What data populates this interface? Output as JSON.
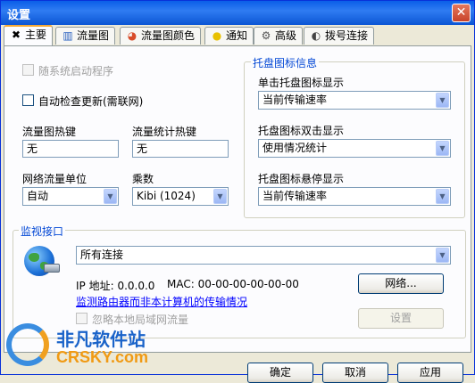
{
  "window": {
    "title": "设置",
    "close": "✕"
  },
  "tabs": [
    {
      "label": "主要",
      "icon": "wrench-icon",
      "glyph": "✖",
      "active": true
    },
    {
      "label": "流量图",
      "icon": "chart-icon",
      "glyph": "▥"
    },
    {
      "label": "流量图颜色",
      "icon": "palette-icon",
      "glyph": "◕"
    },
    {
      "label": "通知",
      "icon": "bulb-icon",
      "glyph": "💡"
    },
    {
      "label": "高级",
      "icon": "settings-icon",
      "glyph": "⚙"
    },
    {
      "label": "拨号连接",
      "icon": "modem-icon",
      "glyph": "◐"
    }
  ],
  "general": {
    "autostart_label": "随系统启动程序",
    "autoupdate_label": "自动检查更新(需联网)",
    "graph_hotkey_label": "流量图热键",
    "graph_hotkey_value": "无",
    "stats_hotkey_label": "流量统计热键",
    "stats_hotkey_value": "无",
    "unit_label": "网络流量单位",
    "unit_value": "自动",
    "multiplier_label": "乘数",
    "multiplier_value": "Kibi (1024)"
  },
  "tray": {
    "group_title": "托盘图标信息",
    "click_label": "单击托盘图标显示",
    "click_value": "当前传输速率",
    "dblclick_label": "托盘图标双击显示",
    "dblclick_value": "使用情况统计",
    "hover_label": "托盘图标悬停显示",
    "hover_value": "当前传输速率"
  },
  "monitor": {
    "group_title": "监视接口",
    "interface_value": "所有连接",
    "ip_text": "IP 地址: 0.0.0.0",
    "mac_text": "MAC: 00-00-00-00-00-00",
    "network_button": "网络...",
    "router_link": "监测路由器而非本计算机的传输情况",
    "ignore_lan_label": "忽略本地局域网流量",
    "settings_button": "设置"
  },
  "footer": {
    "ok_button": "确定",
    "cancel_button": "取消",
    "apply_button": "应用"
  },
  "watermark": {
    "line1": "非凡软件站",
    "line2": "CRSKY.com"
  }
}
